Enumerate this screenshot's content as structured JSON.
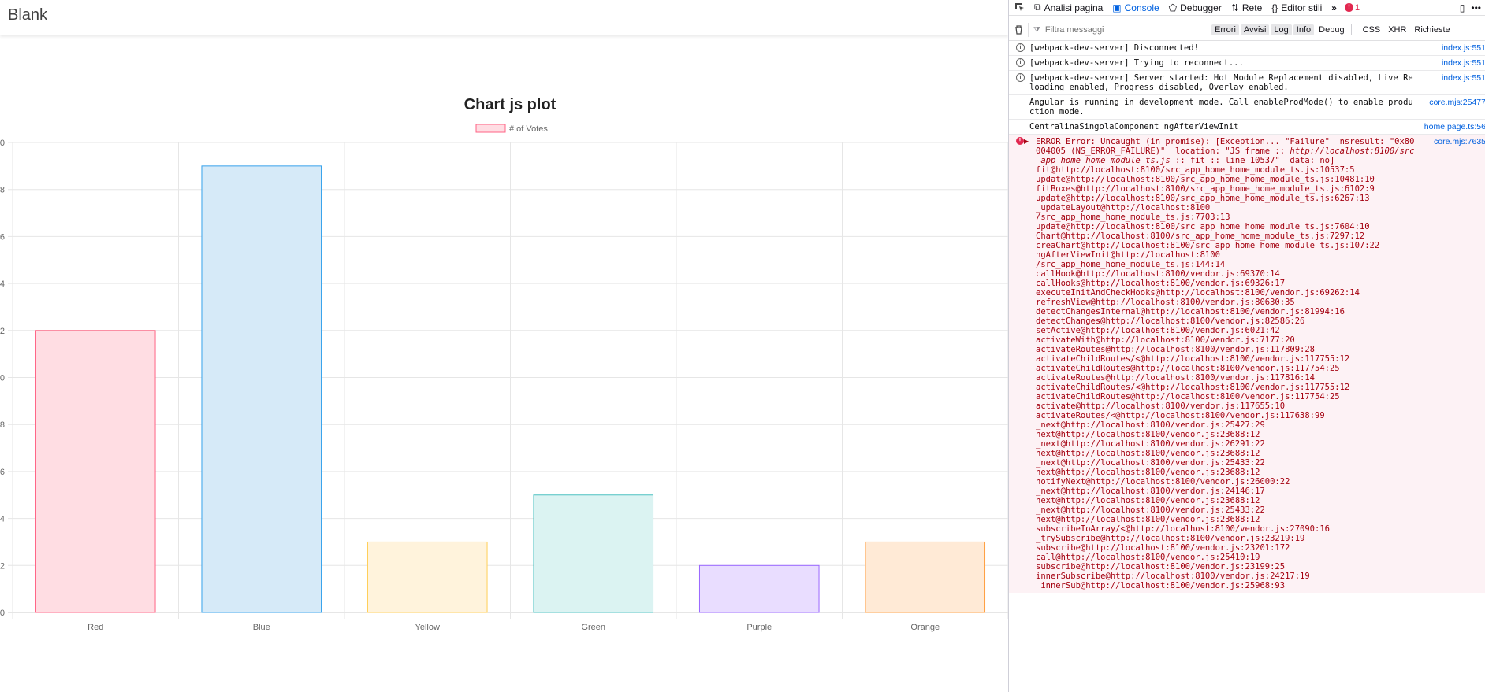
{
  "app": {
    "title": "Blank"
  },
  "chart_data": {
    "type": "bar",
    "title": "Chart js plot",
    "categories": [
      "Red",
      "Blue",
      "Yellow",
      "Green",
      "Purple",
      "Orange"
    ],
    "series": [
      {
        "name": "# of Votes",
        "values": [
          12,
          19,
          3,
          5,
          2,
          3
        ]
      }
    ],
    "colors": {
      "fill": [
        "#ffdde3",
        "#d6eaf8",
        "#fff3dc",
        "#dbf3f2",
        "#e9ddff",
        "#ffead6"
      ],
      "border": [
        "#ff6384",
        "#36a2eb",
        "#ffce56",
        "#4bc0c0",
        "#9966ff",
        "#ff9f40"
      ]
    },
    "ylim": [
      0,
      20
    ],
    "yticks": [
      "0",
      "2",
      "4",
      "6",
      "8",
      "0",
      "2",
      "4",
      "6",
      "8",
      "0"
    ],
    "grid": true,
    "legend": "top"
  },
  "devtools": {
    "tabs": [
      {
        "icon": "⧉",
        "name": "inspector-icon",
        "label": "Analisi pagina"
      },
      {
        "icon": "▣",
        "name": "console-icon",
        "label": "Console",
        "active": true
      },
      {
        "icon": "⬠",
        "name": "debugger-icon",
        "label": "Debugger"
      },
      {
        "icon": "⇅",
        "name": "network-icon",
        "label": "Rete"
      },
      {
        "icon": "{}",
        "name": "style-editor-icon",
        "label": "Editor stili"
      }
    ],
    "error_count": "1",
    "filter": {
      "placeholder": "Filtra messaggi",
      "levels": [
        "Errori",
        "Avvisi",
        "Log",
        "Info",
        "Debug"
      ],
      "active_levels": [
        0,
        1,
        2,
        3
      ],
      "types": [
        "CSS",
        "XHR",
        "Richieste"
      ]
    },
    "messages": [
      {
        "kind": "info",
        "text": "[webpack-dev-server] Disconnected!",
        "source": "index.js:551"
      },
      {
        "kind": "info",
        "text": "[webpack-dev-server] Trying to reconnect...",
        "source": "index.js:551"
      },
      {
        "kind": "info",
        "text": "[webpack-dev-server] Server started: Hot Module Replacement disabled, Live Reloading enabled, Progress disabled, Overlay enabled.",
        "source": "index.js:551"
      },
      {
        "kind": "log",
        "text": "Angular is running in development mode. Call enableProdMode() to enable production mode.",
        "source": "core.mjs:25477"
      },
      {
        "kind": "log",
        "text": "CentralinaSingolaComponent ngAfterViewInit",
        "source": "home.page.ts:56"
      }
    ],
    "error": {
      "head_1": "ERROR Error: Uncaught (in promise): [Exception... \"Failure\"  nsresult: \"0x80004005 (NS_ERROR_FAILURE)\"  location: \"JS frame :: ",
      "head_loc": "http://localhost:8100/src_app_home_home_module_ts.js",
      "head_2": " :: fit :: line 10537\"  data: no]",
      "source": "core.mjs:7635",
      "trace": [
        "fit@http://localhost:8100/src_app_home_home_module_ts.js:10537:5",
        "update@http://localhost:8100/src_app_home_home_module_ts.js:10481:10",
        "fitBoxes@http://localhost:8100/src_app_home_home_module_ts.js:6102:9",
        "update@http://localhost:8100/src_app_home_home_module_ts.js:6267:13",
        "_updateLayout@http://localhost:8100",
        "/src_app_home_home_module_ts.js:7703:13",
        "update@http://localhost:8100/src_app_home_home_module_ts.js:7604:10",
        "Chart@http://localhost:8100/src_app_home_home_module_ts.js:7297:12",
        "creaChart@http://localhost:8100/src_app_home_home_module_ts.js:107:22",
        "ngAfterViewInit@http://localhost:8100",
        "/src_app_home_home_module_ts.js:144:14",
        "callHook@http://localhost:8100/vendor.js:69370:14",
        "callHooks@http://localhost:8100/vendor.js:69326:17",
        "executeInitAndCheckHooks@http://localhost:8100/vendor.js:69262:14",
        "refreshView@http://localhost:8100/vendor.js:80630:35",
        "detectChangesInternal@http://localhost:8100/vendor.js:81994:16",
        "detectChanges@http://localhost:8100/vendor.js:82586:26",
        "setActive@http://localhost:8100/vendor.js:6021:42",
        "activateWith@http://localhost:8100/vendor.js:7177:20",
        "activateRoutes@http://localhost:8100/vendor.js:117809:28",
        "activateChildRoutes/<@http://localhost:8100/vendor.js:117755:12",
        "activateChildRoutes@http://localhost:8100/vendor.js:117754:25",
        "activateRoutes@http://localhost:8100/vendor.js:117816:14",
        "activateChildRoutes/<@http://localhost:8100/vendor.js:117755:12",
        "activateChildRoutes@http://localhost:8100/vendor.js:117754:25",
        "activate@http://localhost:8100/vendor.js:117655:10",
        "activateRoutes/<@http://localhost:8100/vendor.js:117638:99",
        "_next@http://localhost:8100/vendor.js:25427:29",
        "next@http://localhost:8100/vendor.js:23688:12",
        "_next@http://localhost:8100/vendor.js:26291:22",
        "next@http://localhost:8100/vendor.js:23688:12",
        "_next@http://localhost:8100/vendor.js:25433:22",
        "next@http://localhost:8100/vendor.js:23688:12",
        "notifyNext@http://localhost:8100/vendor.js:26000:22",
        "_next@http://localhost:8100/vendor.js:24146:17",
        "next@http://localhost:8100/vendor.js:23688:12",
        "_next@http://localhost:8100/vendor.js:25433:22",
        "next@http://localhost:8100/vendor.js:23688:12",
        "subscribeToArray/<@http://localhost:8100/vendor.js:27090:16",
        "_trySubscribe@http://localhost:8100/vendor.js:23219:19",
        "subscribe@http://localhost:8100/vendor.js:23201:172",
        "call@http://localhost:8100/vendor.js:25410:19",
        "subscribe@http://localhost:8100/vendor.js:23199:25",
        "innerSubscribe@http://localhost:8100/vendor.js:24217:19",
        "_innerSub@http://localhost:8100/vendor.js:25968:93"
      ]
    }
  }
}
